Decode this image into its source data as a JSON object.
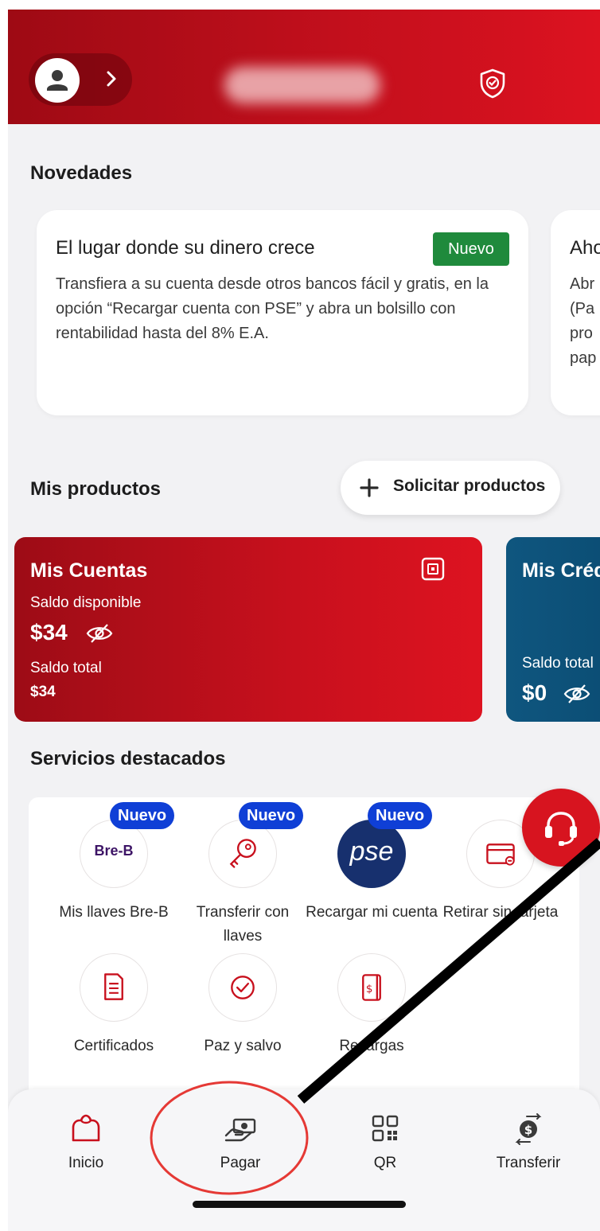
{
  "colors": {
    "brand_red": "#c20f1c",
    "new_badge_green": "#1f8a3c",
    "new_badge_blue": "#0f3fd6",
    "credits_blue": "#0f567f",
    "annotation_red": "#e53935",
    "annotation_line": "#000000"
  },
  "header": {
    "profile_icon": "user-icon",
    "chevron_icon": "chevron-right-icon",
    "security_icon": "shield-check-icon"
  },
  "news": {
    "title": "Novedades",
    "cards": [
      {
        "title": "El lugar donde su dinero crece",
        "badge": "Nuevo",
        "body": "Transfiera a su cuenta desde otros bancos fácil y gratis, en la opción “Recargar cuenta con PSE” y abra un bolsillo con rentabilidad hasta del 8% E.A."
      },
      {
        "title": "Aho",
        "body": "Abr\n(Pa\npro\npap"
      }
    ]
  },
  "products": {
    "title": "Mis productos",
    "request_button": "Solicitar productos",
    "accounts": {
      "title": "Mis Cuentas",
      "available_label": "Saldo disponible",
      "available_amount": "$34",
      "total_label": "Saldo total",
      "total_amount": "$34"
    },
    "credits": {
      "title": "Mis Créd",
      "total_label": "Saldo total",
      "total_amount": "$0"
    }
  },
  "services": {
    "title": "Servicios destacados",
    "items": [
      {
        "label": "Mis llaves Bre-B",
        "badge": "Nuevo",
        "icon_text": "Bre-B",
        "icon": "bre-b-logo"
      },
      {
        "label": "Transferir con llaves",
        "badge": "Nuevo",
        "icon": "key-icon"
      },
      {
        "label": "Recargar mi cuenta",
        "badge": "Nuevo",
        "icon_text": "pse",
        "icon": "pse-logo"
      },
      {
        "label": "Retirar sin tarjeta",
        "icon": "card-withdraw-icon"
      },
      {
        "label": "Certificados",
        "icon": "document-icon"
      },
      {
        "label": "Paz y salvo",
        "icon": "check-circle-icon"
      },
      {
        "label": "Recargas",
        "icon": "phone-recharge-icon"
      }
    ]
  },
  "support": {
    "icon": "headset-icon"
  },
  "bottom_nav": [
    {
      "label": "Inicio",
      "icon": "home-icon"
    },
    {
      "label": "Pagar",
      "icon": "pay-icon"
    },
    {
      "label": "QR",
      "icon": "qr-icon"
    },
    {
      "label": "Transferir",
      "icon": "transfer-icon"
    }
  ]
}
